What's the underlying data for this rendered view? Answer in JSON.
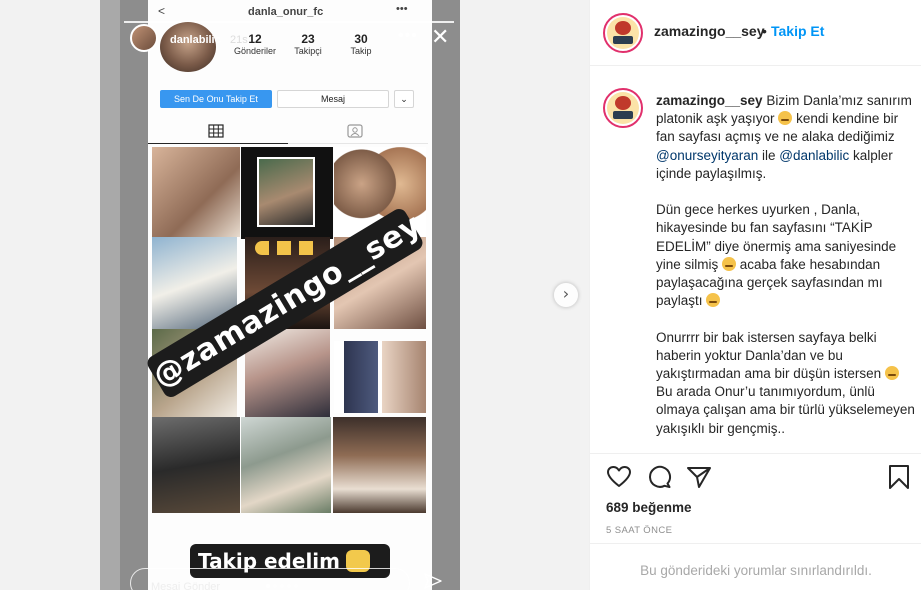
{
  "story": {
    "top_username": "danla_onur_fc",
    "author_name": "danlabilic",
    "time_ago": "21s",
    "stats": [
      {
        "value": "12",
        "label": "Gönderiler"
      },
      {
        "value": "23",
        "label": "Takipçi"
      },
      {
        "value": "30",
        "label": "Takip"
      }
    ],
    "follow_button": "Sen De Onu Takip Et",
    "message_button": "Mesaj",
    "dropdown_icon": "chevron-down",
    "sticker_text": "@zamazingo__sey",
    "bottom_sticker_text": "Takip edelim",
    "reply_placeholder": "Mesaj Gönder"
  },
  "post": {
    "username": "zamazingo__sey",
    "separator": "•",
    "follow_label": "Takip Et",
    "caption_segments": [
      {
        "type": "user",
        "text": "zamazingo__sey"
      },
      {
        "type": "text",
        "text": " Bizim Danla’mız sanırım platonik aşk yaşıyor "
      },
      {
        "type": "emoji",
        "text": ""
      },
      {
        "type": "text",
        "text": " kendi kendine bir fan sayfası açmış ve ne alaka dediğimiz "
      },
      {
        "type": "mention",
        "text": "@onurseyityaran"
      },
      {
        "type": "text",
        "text": " ile "
      },
      {
        "type": "mention",
        "text": "@danlabilic"
      },
      {
        "type": "text",
        "text": " kalpler içinde paylaşılmış.\n\nDün gece herkes uyurken , Danla, hikayesinde bu fan sayfasını “TAKİP EDELİM” diye önermiş ama saniyesinde yine silmiş "
      },
      {
        "type": "emoji",
        "text": ""
      },
      {
        "type": "text",
        "text": " acaba fake hesabından paylaşacağına gerçek sayfasından mı paylaştı "
      },
      {
        "type": "emoji",
        "text": ""
      },
      {
        "type": "text",
        "text": "\n\nOnurrrr bir bak istersen sayfaya belki haberin yoktur Danla’dan ve bu yakıştırmadan ama bir düşün istersen "
      },
      {
        "type": "emoji",
        "text": ""
      },
      {
        "type": "text",
        "text": " Bu arada Onur’u tanımıyordum, ünlü olmaya çalışan ama bir türlü yükselemeyen yakışıklı bir gençmiş.."
      }
    ],
    "likes": "689 beğenme",
    "time": "5 SAAT ÖNCE",
    "comments_restricted": "Bu gönderideki yorumlar sınırlandırıldı.",
    "icons": [
      "heart-icon",
      "comment-icon",
      "share-icon",
      "bookmark-icon"
    ],
    "accent_color": "#0095f6"
  }
}
